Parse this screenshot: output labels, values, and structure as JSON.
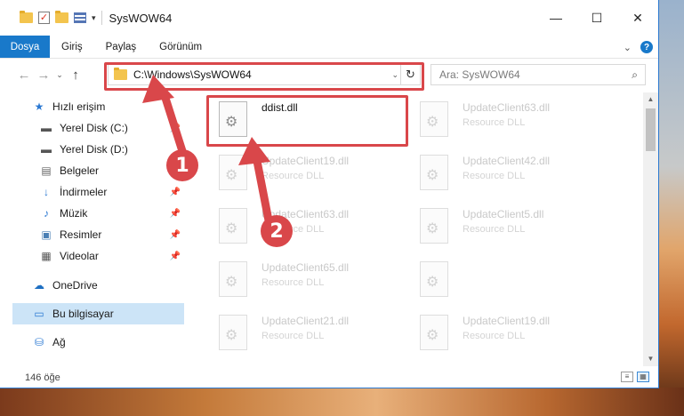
{
  "window": {
    "title": "SysWOW64",
    "controls": {
      "minimize": "—",
      "maximize": "☐",
      "close": "✕"
    }
  },
  "ribbon": {
    "tabs": [
      "Dosya",
      "Giriş",
      "Paylaş",
      "Görünüm"
    ],
    "help": "?"
  },
  "nav": {
    "back": "←",
    "forward": "→",
    "recent": "⌄",
    "up": "↑",
    "address": "C:\\Windows\\SysWOW64",
    "refresh": "↻",
    "search_placeholder": "Ara: SysWOW64"
  },
  "sidebar": {
    "items": [
      {
        "label": "Hızlı erişim",
        "icon": "star-icon"
      },
      {
        "label": "Yerel Disk (C:)",
        "icon": "drive-icon",
        "pinned": true
      },
      {
        "label": "Yerel Disk (D:)",
        "icon": "drive-icon"
      },
      {
        "label": "Belgeler",
        "icon": "documents-icon"
      },
      {
        "label": "İndirmeler",
        "icon": "download-icon",
        "pinned": true
      },
      {
        "label": "Müzik",
        "icon": "music-icon",
        "pinned": true
      },
      {
        "label": "Resimler",
        "icon": "pictures-icon",
        "pinned": true
      },
      {
        "label": "Videolar",
        "icon": "videos-icon",
        "pinned": true
      },
      {
        "label": "OneDrive",
        "icon": "cloud-icon"
      },
      {
        "label": "Bu bilgisayar",
        "icon": "computer-icon",
        "selected": true
      },
      {
        "label": "Ağ",
        "icon": "network-icon"
      }
    ]
  },
  "files": [
    {
      "name": "ddist.dll",
      "desc": "",
      "faded": false
    },
    {
      "name": "UpdateClient63.dll",
      "desc": "Resource DLL",
      "faded": true
    },
    {
      "name": "UpdateClient19.dll",
      "desc": "Resource DLL",
      "faded": true
    },
    {
      "name": "UpdateClient42.dll",
      "desc": "Resource DLL",
      "faded": true
    },
    {
      "name": "UpdateClient63.dll",
      "desc": "Resource DLL",
      "faded": true
    },
    {
      "name": "UpdateClient5.dll",
      "desc": "Resource DLL",
      "faded": true
    },
    {
      "name": "UpdateClient65.dll",
      "desc": "Resource DLL",
      "faded": true
    },
    {
      "name": "",
      "desc": "",
      "faded": true
    },
    {
      "name": "UpdateClient21.dll",
      "desc": "Resource DLL",
      "faded": true
    },
    {
      "name": "UpdateClient19.dll",
      "desc": "Resource DLL",
      "faded": true
    }
  ],
  "status": {
    "count": "146 öğe"
  },
  "annotations": {
    "step1": "1",
    "step2": "2",
    "color": "#d9474a"
  }
}
